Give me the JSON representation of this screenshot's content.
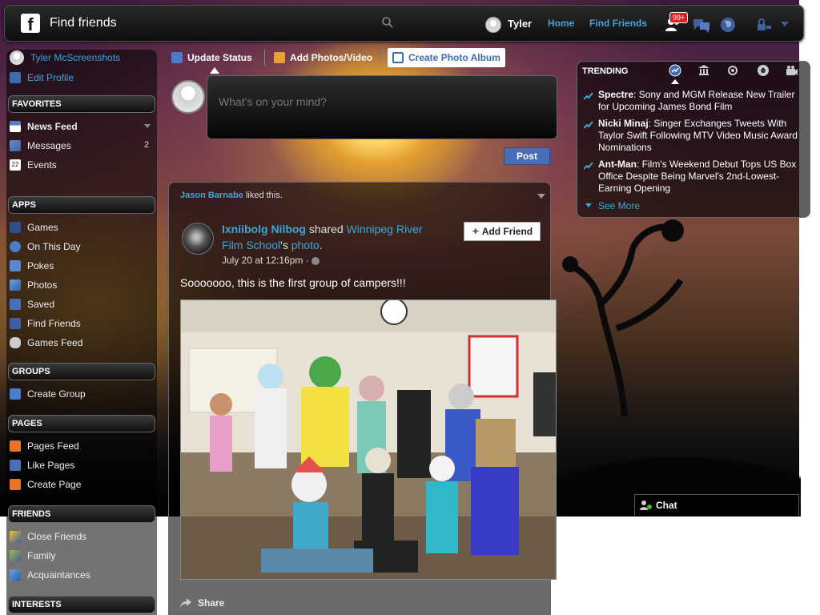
{
  "topbar": {
    "search_value": "Find friends",
    "user_name": "Tyler",
    "nav_home": "Home",
    "nav_find_friends": "Find Friends",
    "notifications_badge": "99+"
  },
  "sidebar": {
    "profile_name": "Tyler McScreenshots",
    "edit_profile": "Edit Profile",
    "sections": {
      "favorites": "FAVORITES",
      "apps": "APPS",
      "groups": "GROUPS",
      "pages": "PAGES",
      "friends": "FRIENDS",
      "interests": "INTERESTS"
    },
    "favorites": [
      {
        "label": "News Feed",
        "icon": "news-feed-icon"
      },
      {
        "label": "Messages",
        "icon": "messages-icon",
        "count": "2"
      },
      {
        "label": "Events",
        "icon": "events-icon",
        "icon_text": "22"
      }
    ],
    "apps": [
      {
        "label": "Games",
        "icon": "games-icon"
      },
      {
        "label": "On This Day",
        "icon": "on-this-day-icon"
      },
      {
        "label": "Pokes",
        "icon": "pokes-icon"
      },
      {
        "label": "Photos",
        "icon": "photos-icon"
      },
      {
        "label": "Saved",
        "icon": "saved-icon"
      },
      {
        "label": "Find Friends",
        "icon": "find-friends-icon"
      },
      {
        "label": "Games Feed",
        "icon": "games-feed-icon"
      }
    ],
    "groups": [
      {
        "label": "Create Group",
        "icon": "create-group-icon"
      }
    ],
    "pages": [
      {
        "label": "Pages Feed",
        "icon": "pages-feed-icon"
      },
      {
        "label": "Like Pages",
        "icon": "like-pages-icon"
      },
      {
        "label": "Create Page",
        "icon": "create-page-icon"
      }
    ],
    "friends": [
      {
        "label": "Close Friends",
        "icon": "close-friends-icon"
      },
      {
        "label": "Family",
        "icon": "family-icon"
      },
      {
        "label": "Acquaintances",
        "icon": "acquaintances-icon"
      }
    ]
  },
  "composer": {
    "tab_update_status": "Update Status",
    "tab_add_photos": "Add Photos/Video",
    "tab_create_album": "Create Photo Album",
    "placeholder": "What's on your mind?",
    "post_button": "Post"
  },
  "story": {
    "context_actor": "Jason Barnabe",
    "context_text": "liked this.",
    "author": "Ixniibolg Nilbog",
    "shared_text": "shared",
    "page_name": "Winnipeg River Film School",
    "possessive": "'s",
    "object": "photo",
    "period": ".",
    "timestamp": "July 20 at 12:16pm",
    "add_friend": "Add Friend",
    "text": "Sooooooo, this is the first group of campers!!!",
    "share": "Share"
  },
  "trending": {
    "title": "TRENDING",
    "tabs": [
      "top-trends-icon",
      "politics-icon",
      "science-tech-icon",
      "sports-icon",
      "entertainment-icon"
    ],
    "items": [
      {
        "topic": "Spectre",
        "text": ": Sony and MGM Release New Trailer for Upcoming James Bond Film"
      },
      {
        "topic": "Nicki Minaj",
        "text": ": Singer Exchanges Tweets With Taylor Swift Following MTV Video Music Award Nominations"
      },
      {
        "topic": "Ant-Man",
        "text": ": Film's Weekend Debut Tops US Box Office Despite Being Marvel's 2nd-Lowest-Earning Opening"
      }
    ],
    "see_more": "See More"
  },
  "chat": {
    "label": "Chat"
  },
  "colors": {
    "link": "#3ba7d8",
    "accent": "#4a6eb5",
    "badge": "#e02020"
  }
}
